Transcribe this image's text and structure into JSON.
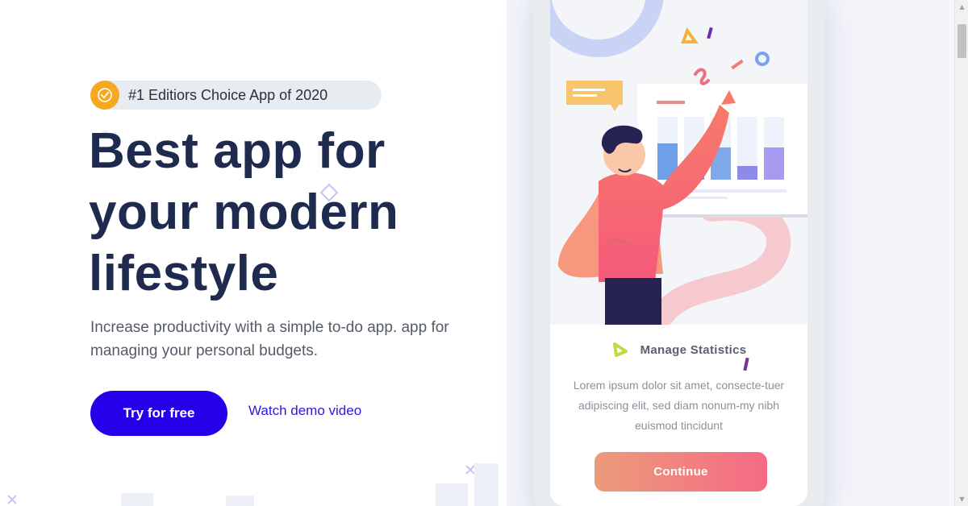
{
  "hero": {
    "badge_text": "#1 Editiors Choice App of 2020",
    "title_line1": "Best app for",
    "title_line2": "your modern",
    "title_line3": "lifestyle",
    "subtitle": "Increase productivity with a simple to-do app. app for managing your personal budgets.",
    "primary_cta": "Try for free",
    "secondary_cta": "Watch demo video"
  },
  "phone_card": {
    "title": "Manage Statistics",
    "body": "Lorem ipsum dolor sit amet, consecte-tuer adipiscing elit, sed diam nonum-my nibh euismod tincidunt",
    "button_label": "Continue"
  },
  "colors": {
    "brand_primary": "#2700ea",
    "heading": "#1f2a4f",
    "badge_accent": "#f7a823",
    "continue_gradient_start": "#ec9b7a",
    "continue_gradient_end": "#f56a85"
  },
  "icons": {
    "badge_icon": "check-circle-icon",
    "card_title_icon": "triangle-icon"
  }
}
